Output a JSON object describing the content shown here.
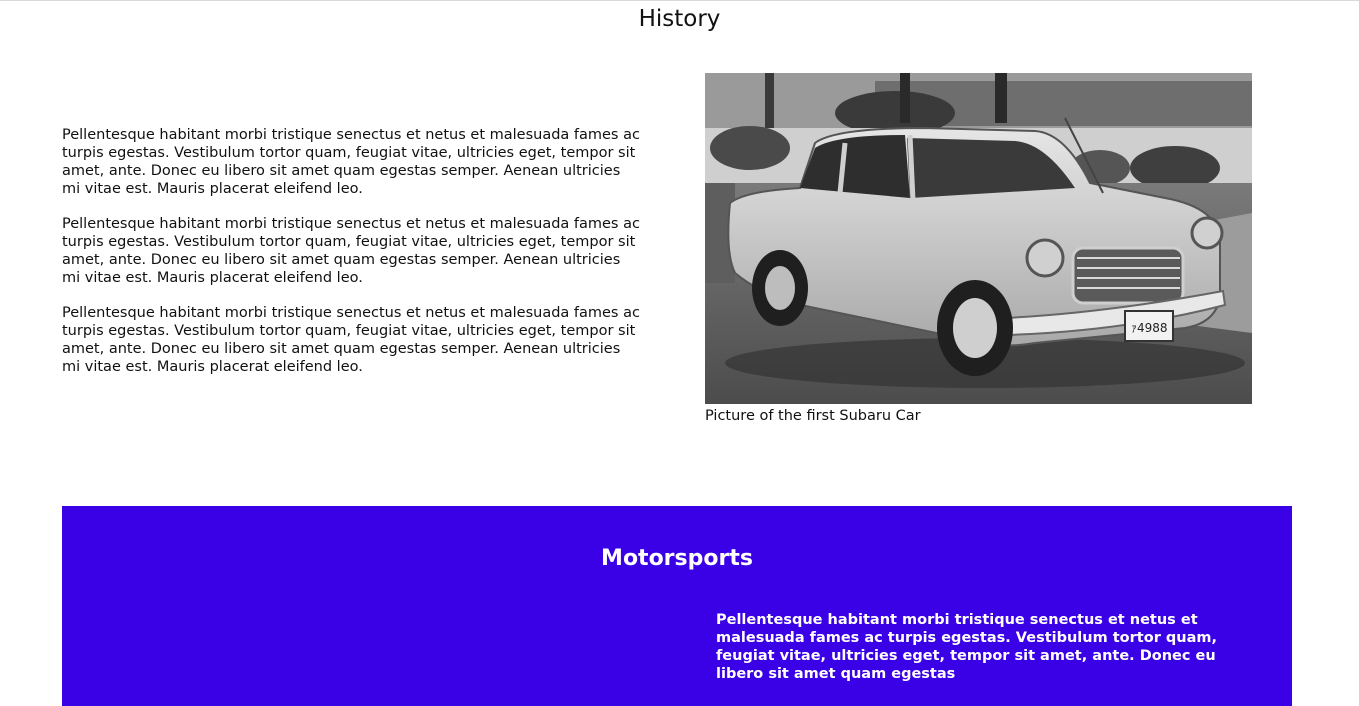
{
  "history": {
    "title": "History",
    "paragraphs": [
      "Pellentesque habitant morbi tristique senectus et netus et malesuada fames ac turpis egestas. Vestibulum tortor quam, feugiat vitae, ultricies eget, tempor sit amet, ante. Donec eu libero sit amet quam egestas semper. Aenean ultricies mi vitae est. Mauris placerat eleifend leo.",
      "Pellentesque habitant morbi tristique senectus et netus et malesuada fames ac turpis egestas. Vestibulum tortor quam, feugiat vitae, ultricies eget, tempor sit amet, ante. Donec eu libero sit amet quam egestas semper. Aenean ultricies mi vitae est. Mauris placerat eleifend leo.",
      "Pellentesque habitant morbi tristique senectus et netus et malesuada fames ac turpis egestas. Vestibulum tortor quam, feugiat vitae, ultricies eget, tempor sit amet, ante. Donec eu libero sit amet quam egestas semper. Aenean ultricies mi vitae est. Mauris placerat eleifend leo."
    ],
    "caption": "Picture of the first Subaru Car"
  },
  "motorsports": {
    "title": "Motorsports",
    "paragraph": "Pellentesque habitant morbi tristique senectus et netus et malesuada fames ac turpis egestas. Vestibulum tortor quam, feugiat vitae, ultricies eget, tempor sit amet, ante. Donec eu libero sit amet quam egestas"
  },
  "colors": {
    "motorsports_background": "#3a00e6",
    "text": "#111111"
  }
}
